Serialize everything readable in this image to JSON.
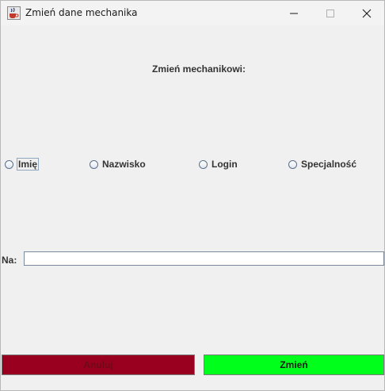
{
  "window": {
    "title": "Zmień dane mechanika",
    "icon": "java-cup-icon",
    "controls": [
      "minimize-icon",
      "maximize-icon",
      "close-icon"
    ]
  },
  "header": {
    "label": "Zmień mechanikowi:"
  },
  "options": {
    "imie": "Imię",
    "nazwisko": "Nazwisko",
    "login": "Login",
    "specjalnosc": "Specjalność"
  },
  "field": {
    "label": "Na:",
    "value": "",
    "placeholder": ""
  },
  "buttons": {
    "cancel": "Anuluj",
    "apply": "Zmień"
  },
  "colors": {
    "cancel_bg": "#990020",
    "apply_bg": "#00ff1a"
  }
}
